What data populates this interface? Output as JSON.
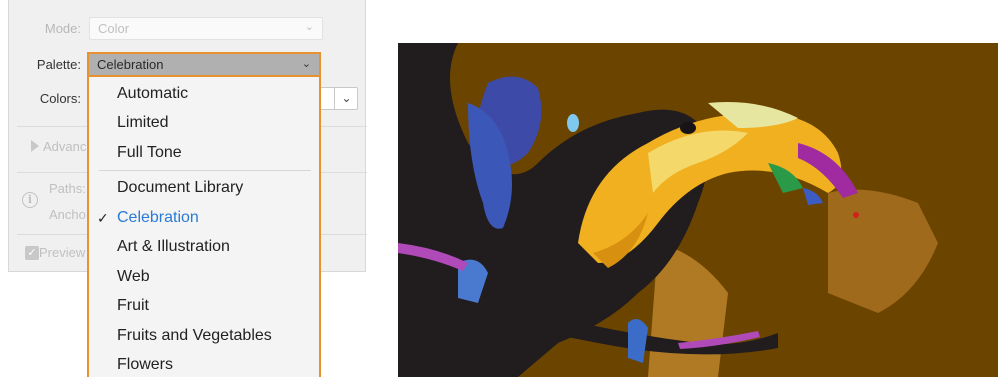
{
  "panel": {
    "mode_label": "Mode:",
    "mode_value": "Color",
    "palette_label": "Palette:",
    "palette_value": "Celebration",
    "colors_label": "Colors:",
    "advanced_label": "Advanc",
    "paths_label": "Paths:",
    "anchors_label": "Ancho",
    "preview_label": "Preview"
  },
  "dropdown": {
    "options": [
      {
        "label": "Automatic"
      },
      {
        "label": "Limited"
      },
      {
        "label": "Full Tone"
      },
      {
        "label": "Document Library"
      },
      {
        "label": "Celebration",
        "selected": true
      },
      {
        "label": "Art & Illustration"
      },
      {
        "label": "Web"
      },
      {
        "label": "Fruit"
      },
      {
        "label": "Fruits and Vegetables"
      },
      {
        "label": "Flowers"
      }
    ],
    "check_glyph": "✓"
  },
  "icons": {
    "chevron": "chevron-down-icon",
    "info": "info-icon",
    "checkbox": "checkbox-icon",
    "disclosure": "disclosure-triangle-icon"
  },
  "colors": {
    "accent_border": "#e8912f",
    "selected_text": "#2a7ad8",
    "art_background": "#6b4500"
  }
}
